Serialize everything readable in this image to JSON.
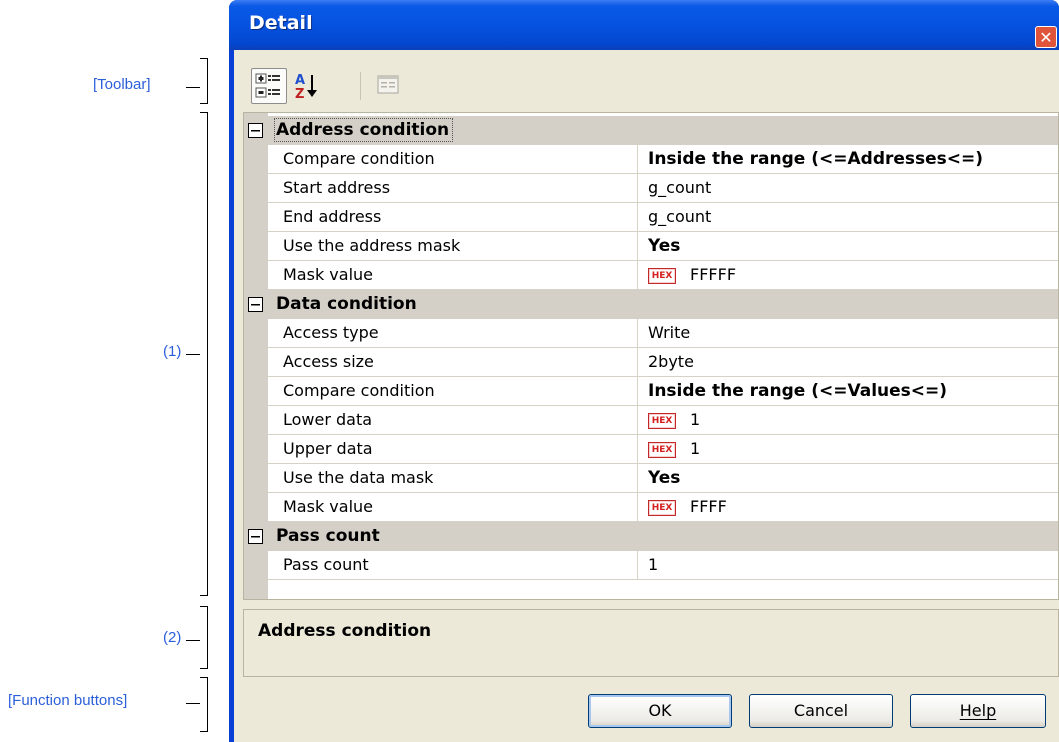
{
  "annotations": {
    "toolbar": "[Toolbar]",
    "grid": "(1)",
    "description": "(2)",
    "buttons": "[Function buttons]"
  },
  "window": {
    "title": "Detail",
    "close_glyph": "✕"
  },
  "toolbar": {
    "buttons": [
      {
        "icon": "categorized-view-icon",
        "active": true
      },
      {
        "icon": "sort-alphabetical-icon",
        "active": false
      },
      {
        "icon": "property-pages-icon",
        "active": false,
        "disabled": true
      }
    ]
  },
  "grid": {
    "categories": [
      {
        "label": "Address condition",
        "expanded": true,
        "rows": [
          {
            "name": "Compare condition",
            "value": "Inside the range (<=Addresses<=)",
            "bold": true
          },
          {
            "name": "Start address",
            "value": "g_count"
          },
          {
            "name": "End address",
            "value": "g_count"
          },
          {
            "name": "Use the address mask",
            "value": "Yes",
            "bold": true
          },
          {
            "name": "Mask value",
            "value": "FFFFF",
            "hex": true
          }
        ]
      },
      {
        "label": "Data condition",
        "expanded": true,
        "rows": [
          {
            "name": "Access type",
            "value": "Write"
          },
          {
            "name": "Access size",
            "value": "2byte"
          },
          {
            "name": "Compare condition",
            "value": "Inside the range (<=Values<=)",
            "bold": true
          },
          {
            "name": "Lower data",
            "value": "1",
            "hex": true
          },
          {
            "name": "Upper data",
            "value": "1",
            "hex": true
          },
          {
            "name": "Use the data mask",
            "value": "Yes",
            "bold": true
          },
          {
            "name": "Mask value",
            "value": "FFFF",
            "hex": true
          }
        ]
      },
      {
        "label": "Pass count",
        "expanded": true,
        "rows": [
          {
            "name": "Pass count",
            "value": "1"
          }
        ]
      }
    ],
    "hex_badge": "HEX"
  },
  "description": {
    "title": "Address condition"
  },
  "buttons": {
    "ok": "OK",
    "cancel": "Cancel",
    "help": "Help"
  },
  "colors": {
    "titlebar": "#0552e0",
    "annotation": "#2b5fd9",
    "dialog_bg": "#ece9d8",
    "category_bg": "#d4d0c8",
    "hex_badge": "#d41f1f"
  }
}
